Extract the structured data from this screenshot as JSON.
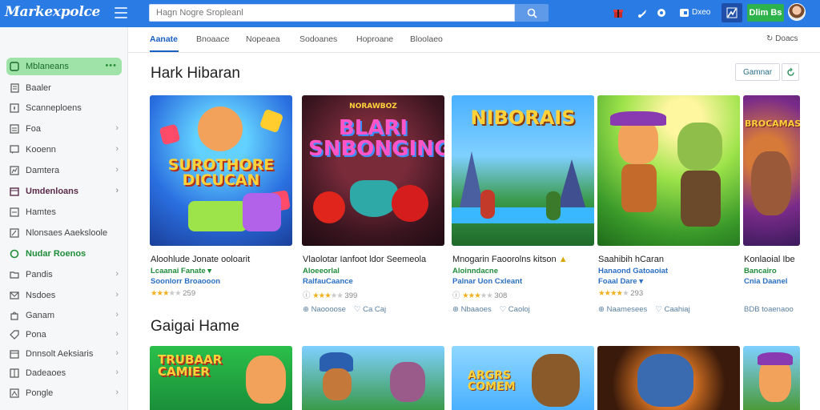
{
  "app": {
    "logo": "Markexpolce"
  },
  "search": {
    "placeholder": "Hagn Nogre Sropleanl"
  },
  "topbar": {
    "coins_label": "Dxeo",
    "signin_label": "Dlim Bs"
  },
  "sidebar": {
    "items": [
      {
        "label": "Mblaneans",
        "icon": "gamepad-icon",
        "active": true
      },
      {
        "label": "Baaler",
        "icon": "document-icon"
      },
      {
        "label": "Scanneploens",
        "icon": "star-icon"
      },
      {
        "label": "Foa",
        "icon": "list-icon",
        "chevron": true
      },
      {
        "label": "Kooenn",
        "icon": "chat-icon",
        "chevron": true
      },
      {
        "label": "Damtera",
        "icon": "chart-icon",
        "chevron": true
      },
      {
        "label": "Umdenloans",
        "icon": "calendar-icon",
        "chevron": true
      },
      {
        "label": "Hamtes",
        "icon": "doc-icon"
      },
      {
        "label": "Nlonsaes Aaeksloole",
        "icon": "edit-icon"
      },
      {
        "label": "Nudar Roenos",
        "icon": "circle-icon"
      },
      {
        "label": "Pandis",
        "icon": "folder-icon",
        "chevron": true
      },
      {
        "label": "Nsdoes",
        "icon": "mail-icon",
        "chevron": true
      },
      {
        "label": "Ganam",
        "icon": "bag-icon",
        "chevron": true
      },
      {
        "label": "Pona",
        "icon": "tag-icon",
        "chevron": true
      },
      {
        "label": "Dnnsolt Aeksiaris",
        "icon": "calendar-icon",
        "chevron": true
      },
      {
        "label": "Dadeaoes",
        "icon": "grid-icon",
        "chevron": true
      },
      {
        "label": "Pongle",
        "icon": "users-icon",
        "chevron": true
      }
    ]
  },
  "tabs": [
    "Aanate",
    "Bnoaace",
    "Nopeaea",
    "Sodoanes",
    "Hoproane",
    "Bloolaeo"
  ],
  "tab_right": "Doacs",
  "section1": {
    "title": "Hark Hibaran",
    "button_label": "Gamnar"
  },
  "section2": {
    "title": "Gaigai Hame"
  },
  "cards": [
    {
      "thumb_text": "SUROTHORE DICUCAN",
      "title": "Aloohlude Jonate ooloarit",
      "developer": "Lcaanai Fanate",
      "tag": "Soonlorr Broaooon",
      "rating": "259",
      "foot1": "",
      "foot2": ""
    },
    {
      "thumb_text": "BLARI SNBONGING",
      "thumb_top": "NORAWBOZ",
      "title": "Vlaolotar Ianfoot ldor Seemeola",
      "developer": "Aloeeorlal",
      "tag": "RalfauCaance",
      "rating": "399",
      "foot1": "Naoooose",
      "foot2": "Ca Caj"
    },
    {
      "thumb_text": "NIBORAIS",
      "title": "Mnogarin Faoorolns kitson",
      "developer": "Aloinndacne",
      "tag": "Palnar Uon Cxleant",
      "rating": "308",
      "foot1": "Nbaaoes",
      "foot2": "Caoloj"
    },
    {
      "thumb_text": "",
      "title": "Saahibih hCaran",
      "developer": "Hanaond Gatoaoiat",
      "tag": "Foaal Dare",
      "rating": "293",
      "foot1": "Naamesees",
      "foot2": "Caahiaj"
    },
    {
      "thumb_text": "BROCAMAS",
      "title": "Konlaoial Ibe",
      "developer": "Bancairo",
      "tag": "Cnia Daanel",
      "rating": "",
      "foot1": "BDB toaenaoo",
      "foot2": ""
    }
  ],
  "cards2": [
    {
      "thumb_text": "TRUBAAR CAMIER"
    },
    {
      "thumb_text": ""
    },
    {
      "thumb_text": "ARGRS COMEM"
    },
    {
      "thumb_text": ""
    },
    {
      "thumb_text": ""
    }
  ]
}
